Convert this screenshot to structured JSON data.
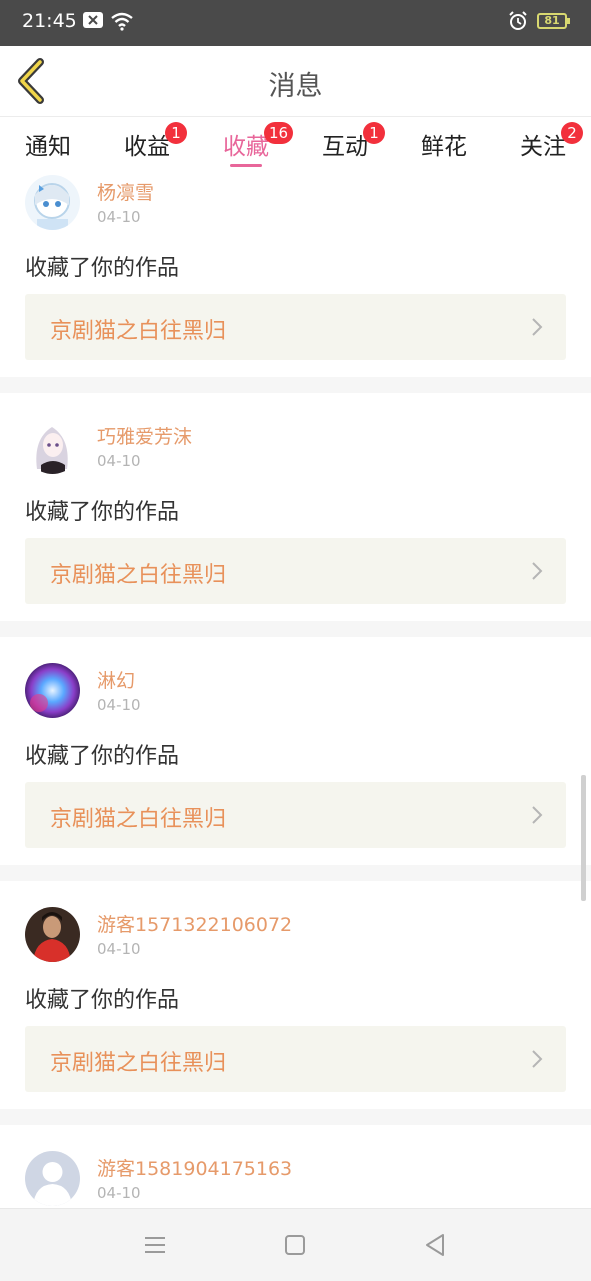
{
  "status_bar": {
    "time": "21:45",
    "battery": "81",
    "icons": [
      "close-notification-icon",
      "wifi-icon",
      "alarm-icon",
      "battery-icon"
    ]
  },
  "header": {
    "title": "消息",
    "back_icon": "chevron-left-icon",
    "accent_color": "#e8669a"
  },
  "tabs": [
    {
      "label": "通知",
      "badge": ""
    },
    {
      "label": "收益",
      "badge": "1"
    },
    {
      "label": "收藏",
      "badge": "16",
      "active": true
    },
    {
      "label": "互动",
      "badge": "1"
    },
    {
      "label": "鲜花",
      "badge": ""
    },
    {
      "label": "关注",
      "badge": "2"
    }
  ],
  "messages": [
    {
      "username": "杨凛雪",
      "date": "04-10",
      "action": "收藏了你的作品",
      "work_title": "京剧猫之白往黑归"
    },
    {
      "username": "巧雅爱芳沫",
      "date": "04-10",
      "action": "收藏了你的作品",
      "work_title": "京剧猫之白往黑归"
    },
    {
      "username": "淋幻",
      "date": "04-10",
      "action": "收藏了你的作品",
      "work_title": "京剧猫之白往黑归"
    },
    {
      "username": "游客1571322106072",
      "date": "04-10",
      "action": "收藏了你的作品",
      "work_title": "京剧猫之白往黑归"
    },
    {
      "username": "游客1581904175163",
      "date": "04-10",
      "action": "",
      "work_title": ""
    }
  ],
  "nav_bar": {
    "icons": [
      "menu-icon",
      "home-square-icon",
      "back-triangle-icon"
    ]
  }
}
